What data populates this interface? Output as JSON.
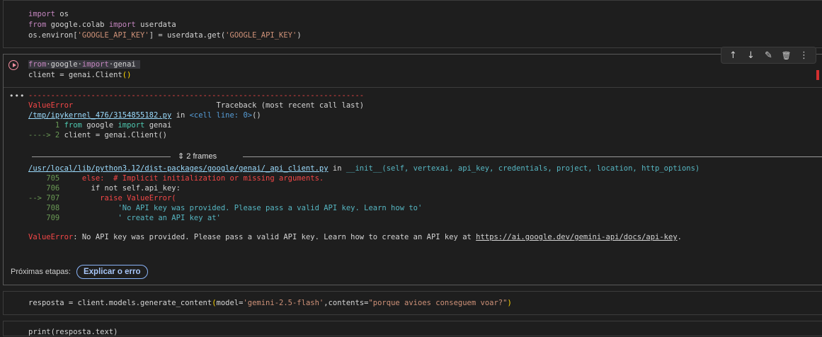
{
  "cell1": {
    "lines": [
      {
        "kw": "import",
        "rest": " os"
      },
      {
        "kw1": "from",
        "mid": " google.colab ",
        "kw2": "import",
        "rest": " userdata"
      }
    ],
    "line3_a": "os.environ[",
    "line3_str": "'GOOGLE_API_KEY'",
    "line3_b": "] = userdata.get(",
    "line3_str2": "'GOOGLE_API_KEY'",
    "line3_c": ")"
  },
  "cell2": {
    "code_l1_from": "from",
    "code_l1_mod": "google",
    "code_l1_import": "import",
    "code_l1_name": "genai",
    "code_l2_a": "client = genai.Client",
    "code_l2_paren": "()",
    "toolbar": {
      "up": "↑",
      "down": "↓",
      "edit": "✎",
      "delete": "🗑",
      "more": "⋮"
    },
    "output_dots": "•••",
    "tb_dashes": "---------------------------------------------------------------------------",
    "tb_error": "ValueError",
    "tb_header": "                                Traceback (most recent call last)",
    "tb_file1": "/tmp/ipykernel_476/3154855182.py",
    "tb_in": " in ",
    "tb_cell": "<cell line: 0>",
    "tb_cell_parens": "()",
    "tb_l1_num": "      1 ",
    "tb_l1_from": "from",
    "tb_l1_mid": " google ",
    "tb_l1_import": "import",
    "tb_l1_rest": " genai",
    "tb_l2_arrow": "----> 2 ",
    "tb_l2_rest": "client = genai.Client()",
    "frames_label": "⇕ 2 frames",
    "tb_file2": "/usr/local/lib/python3.12/dist-packages/google/genai/_api_client.py",
    "tb_file2_in": " in ",
    "tb_file2_func": "__init__(self, vertexai, api_key, credentials, project, location, http_options)",
    "src": [
      {
        "num": "    705",
        "code": "     else:  # Implicit initialization or missing arguments."
      },
      {
        "num": "    706",
        "code": "       if not self.api_key:"
      },
      {
        "num": "--> 707",
        "code": "         raise ValueError("
      },
      {
        "num": "    708",
        "code": "             'No API key was provided. Please pass a valid API key. Learn how to'"
      },
      {
        "num": "    709",
        "code": "             ' create an API key at'"
      }
    ],
    "final_err": "ValueError",
    "final_msg": ": No API key was provided. Please pass a valid API key. Learn how to create an API key at ",
    "final_link": "https://ai.google.dev/gemini-api/docs/api-key",
    "final_dot": ".",
    "next_steps_label": "Próximas etapas:",
    "explain_chip": "Explicar o erro"
  },
  "cell3": {
    "a": "resposta = client.models.generate_content",
    "p1": "(",
    "b": "model=",
    "s1": "'gemini-2.5-flash'",
    "c": ",contents=",
    "s2": "\"porque avioes conseguem voar?\"",
    "p2": ")"
  },
  "cell4": {
    "text": "print(resposta.text)"
  }
}
